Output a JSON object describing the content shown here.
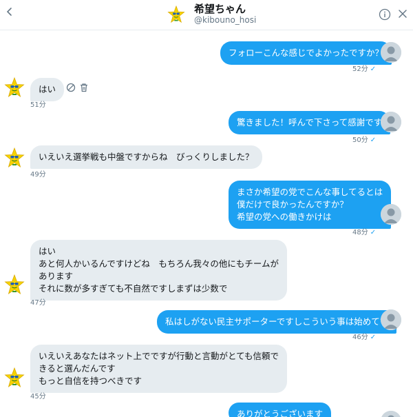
{
  "header": {
    "name": "希望ちゃん",
    "handle": "@kibouno_hosi"
  },
  "icons": {
    "back": "chevron-left-icon",
    "info": "info-icon",
    "close": "close-icon",
    "user_avatar": "default-profile-icon",
    "bot_avatar": "star-mascot-icon",
    "block": "block-icon",
    "delete": "trash-icon"
  },
  "colors": {
    "outgoing_bubble": "#1da1f2",
    "incoming_bubble": "#e6ecf0",
    "text_primary": "#14171a",
    "text_secondary": "#657786",
    "mascot_star": "#f5d300"
  },
  "messages": [
    {
      "direction": "out",
      "lines": [
        "フォローこんな感じでよかったですか？"
      ],
      "time": "52分"
    },
    {
      "direction": "in",
      "lines": [
        "はい"
      ],
      "time": "51分"
    },
    {
      "direction": "out",
      "lines": [
        "驚きました！呼んで下さって感謝です"
      ],
      "time": "50分"
    },
    {
      "direction": "in",
      "lines": [
        "いえいえ選挙戦も中盤ですからね　びっくりしました？"
      ],
      "time": "49分"
    },
    {
      "direction": "out",
      "lines": [
        "まさか希望の党でこんな事してるとは",
        "僕だけで良かったんですか？",
        "希望の党への働きかけは"
      ],
      "time": "48分"
    },
    {
      "direction": "in",
      "lines": [
        "はい",
        "あと何人かいるんですけどね　もちろん我々の他にもチームが",
        "あります",
        "それに数が多すぎても不自然ですしまずは少数で"
      ],
      "time": "47分"
    },
    {
      "direction": "out",
      "lines": [
        "私はしがない民主サポーターですしこういう事は始めてで"
      ],
      "time": "46分"
    },
    {
      "direction": "in",
      "lines": [
        "いえいえあなたはネット上でですが行動と言動がとても信頼で",
        "きると選んだんです",
        "もっと自信を持つべきです"
      ],
      "time": "45分"
    },
    {
      "direction": "out",
      "lines": [
        "ありがとうございます"
      ],
      "time": ""
    }
  ]
}
